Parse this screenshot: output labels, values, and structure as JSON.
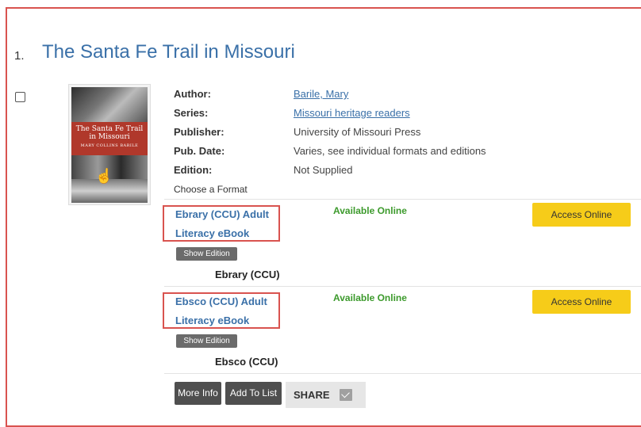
{
  "result": {
    "number": "1.",
    "title": "The Santa Fe Trail in Missouri",
    "cover": {
      "title": "The Santa Fe Trail in Missouri",
      "author": "MARY COLLINS BARILE"
    },
    "details": [
      {
        "label": "Author:",
        "value": "Barile, Mary",
        "link": true
      },
      {
        "label": "Series:",
        "value": "Missouri heritage readers",
        "link": true
      },
      {
        "label": "Publisher:",
        "value": "University of Missouri Press",
        "link": false
      },
      {
        "label": "Pub. Date:",
        "value": "Varies, see individual formats and editions",
        "link": false
      },
      {
        "label": "Edition:",
        "value": "Not Supplied",
        "link": false
      }
    ],
    "choose_format": "Choose a Format",
    "formats": [
      {
        "line1": "Ebrary (CCU) Adult",
        "line2": "Literacy eBook",
        "availability": "Available Online",
        "access_label": "Access Online",
        "show_edition": "Show Edition",
        "source": "Ebrary (CCU)"
      },
      {
        "line1": "Ebsco (CCU) Adult",
        "line2": "Literacy eBook",
        "availability": "Available Online",
        "access_label": "Access Online",
        "show_edition": "Show Edition",
        "source": "Ebsco (CCU)"
      }
    ],
    "actions": {
      "more_info": "More Info",
      "add_to_list": "Add To List",
      "share": "SHARE"
    }
  },
  "colors": {
    "link": "#3a70a8",
    "available": "#3c9a2c",
    "access_button": "#f6cc19",
    "highlight_border": "#d9534f"
  }
}
